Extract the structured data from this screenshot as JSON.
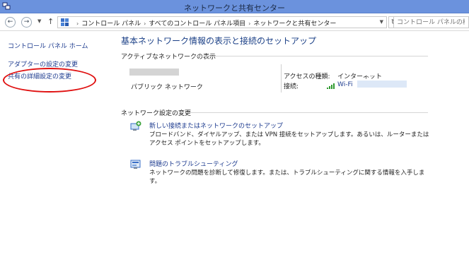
{
  "window": {
    "title": "ネットワークと共有センター"
  },
  "address": {
    "crumbs": [
      "コントロール パネル",
      "すべてのコントロール パネル項目",
      "ネットワークと共有センター"
    ],
    "search_placeholder": "コントロール パネルの検索"
  },
  "sidebar": {
    "items": [
      {
        "label": "コントロール パネル ホーム"
      },
      {
        "label": "アダプターの設定の変更"
      },
      {
        "label": "共有の詳細設定の変更"
      }
    ]
  },
  "main": {
    "heading": "基本ネットワーク情報の表示と接続のセットアップ",
    "active_networks_label": "アクティブなネットワークの表示",
    "network_type": "パブリック ネットワーク",
    "access_type_label": "アクセスの種類:",
    "access_type_value": "インターネット",
    "connection_label": "接続:",
    "connection_value": "Wi-Fi",
    "change_settings_label": "ネットワーク設定の変更",
    "tasks": [
      {
        "link": "新しい接続またはネットワークのセットアップ",
        "desc": "ブロードバンド、ダイヤルアップ、または VPN 接続をセットアップします。あるいは、ルーターまたはアクセス ポイントをセットアップします。"
      },
      {
        "link": "問題のトラブルシューティング",
        "desc": "ネットワークの問題を診断して修復します。または、トラブルシューティングに関する情報を入手します。"
      }
    ]
  },
  "colors": {
    "link": "#1d3b8f",
    "heading": "#1a3f86",
    "titlebar": "#6b92dd",
    "highlight_oval": "#e01010"
  }
}
